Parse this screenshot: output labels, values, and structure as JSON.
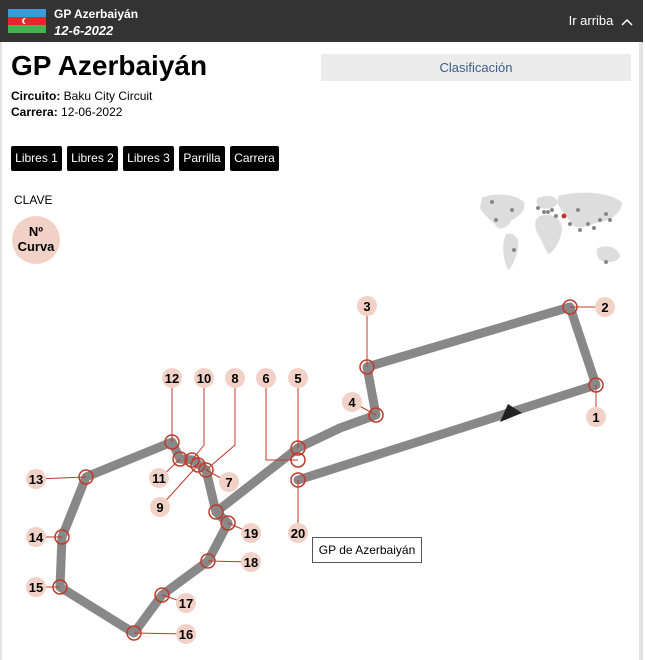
{
  "header": {
    "title": "GP Azerbaiyán",
    "date": "12-6-2022",
    "scroll_top_label": "Ir arriba"
  },
  "race": {
    "title": "GP Azerbaiyán",
    "classification_label": "Clasificación",
    "circuit_label": "Circuito:",
    "circuit_value": " Baku City Circuit",
    "race_label": "Carrera:",
    "race_value": " 12-06-2022"
  },
  "sessions": [
    "Libres 1",
    "Libres 2",
    "Libres 3",
    "Parrilla",
    "Carrera"
  ],
  "legend": {
    "title": "CLAVE",
    "line1": "Nº",
    "line2": "Curva"
  },
  "tooltip": "GP de Azerbaiyán",
  "colors": {
    "track": "#888888",
    "turn_ring": "#c0392b",
    "turn_label_bg": "#f2d2c7",
    "map_land": "#dddddd",
    "map_dot": "#888888",
    "map_highlight": "#c0392b"
  },
  "turns": [
    "1",
    "2",
    "3",
    "4",
    "5",
    "6",
    "7",
    "8",
    "9",
    "10",
    "11",
    "12",
    "13",
    "14",
    "15",
    "16",
    "17",
    "18",
    "19",
    "20"
  ]
}
